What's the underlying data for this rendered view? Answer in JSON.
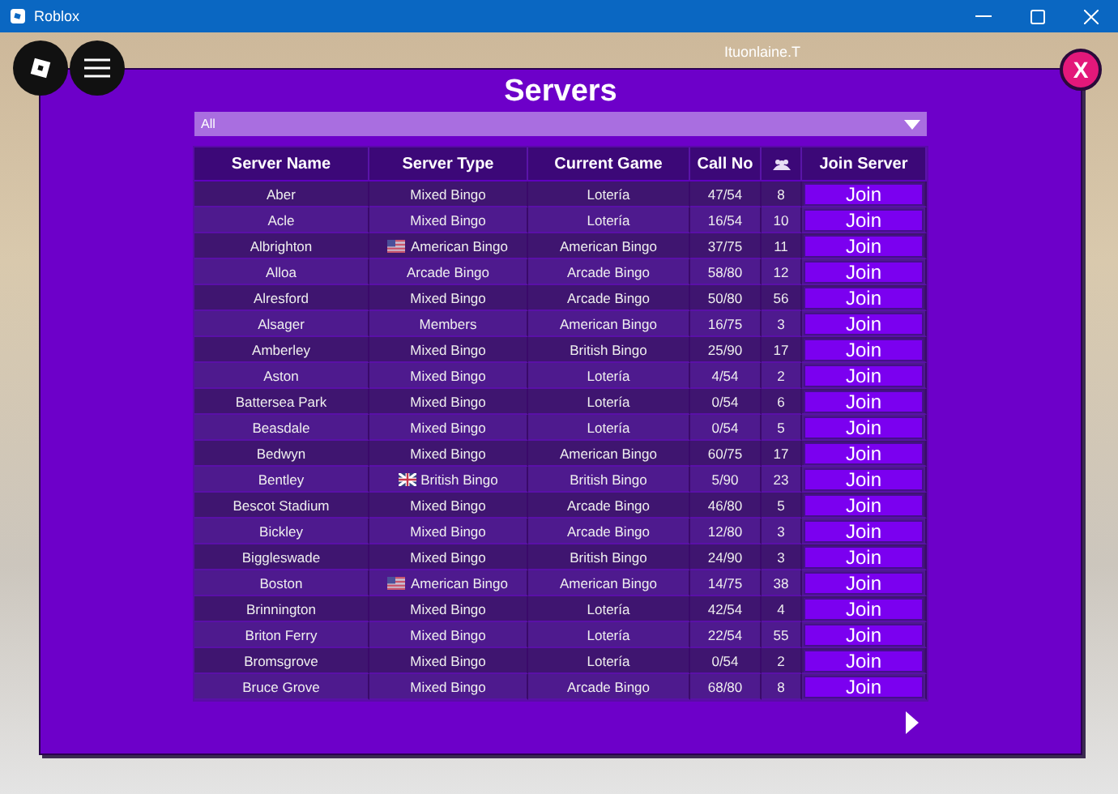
{
  "window": {
    "title": "Roblox"
  },
  "game": {
    "player_name": "Ituonlaine.T"
  },
  "panel": {
    "title": "Servers",
    "filter": {
      "value": "All"
    },
    "columns": [
      {
        "kind": "text",
        "label": "Server Name"
      },
      {
        "kind": "text",
        "label": "Server Type"
      },
      {
        "kind": "text",
        "label": "Current Game"
      },
      {
        "kind": "text",
        "label": "Call No"
      },
      {
        "kind": "icon"
      },
      {
        "kind": "text",
        "label": "Join Server"
      }
    ],
    "rows": [
      {
        "kind": "plain",
        "name": "Aber",
        "type": "Mixed Bingo",
        "game": "Lotería",
        "call": "47/54",
        "players": "8",
        "action": "Join"
      },
      {
        "kind": "plain",
        "name": "Acle",
        "type": "Mixed Bingo",
        "game": "Lotería",
        "call": "16/54",
        "players": "10",
        "action": "Join"
      },
      {
        "kind": "american",
        "name": "Albrighton",
        "type": "American Bingo",
        "game": "American Bingo",
        "call": "37/75",
        "players": "11",
        "action": "Join"
      },
      {
        "kind": "plain",
        "name": "Alloa",
        "type": "Arcade Bingo",
        "game": "Arcade Bingo",
        "call": "58/80",
        "players": "12",
        "action": "Join"
      },
      {
        "kind": "plain",
        "name": "Alresford",
        "type": "Mixed Bingo",
        "game": "Arcade Bingo",
        "call": "50/80",
        "players": "56",
        "action": "Join"
      },
      {
        "kind": "plain",
        "name": "Alsager",
        "type": "Members",
        "game": "American Bingo",
        "call": "16/75",
        "players": "3",
        "action": "Join"
      },
      {
        "kind": "plain",
        "name": "Amberley",
        "type": "Mixed Bingo",
        "game": "British Bingo",
        "call": "25/90",
        "players": "17",
        "action": "Join"
      },
      {
        "kind": "plain",
        "name": "Aston",
        "type": "Mixed Bingo",
        "game": "Lotería",
        "call": "4/54",
        "players": "2",
        "action": "Join"
      },
      {
        "kind": "plain",
        "name": "Battersea Park",
        "type": "Mixed Bingo",
        "game": "Lotería",
        "call": "0/54",
        "players": "6",
        "action": "Join"
      },
      {
        "kind": "plain",
        "name": "Beasdale",
        "type": "Mixed Bingo",
        "game": "Lotería",
        "call": "0/54",
        "players": "5",
        "action": "Join"
      },
      {
        "kind": "plain",
        "name": "Bedwyn",
        "type": "Mixed Bingo",
        "game": "American Bingo",
        "call": "60/75",
        "players": "17",
        "action": "Join"
      },
      {
        "kind": "british",
        "name": "Bentley",
        "type": "British Bingo",
        "game": "British Bingo",
        "call": "5/90",
        "players": "23",
        "action": "Join"
      },
      {
        "kind": "plain",
        "name": "Bescot Stadium",
        "type": "Mixed Bingo",
        "game": "Arcade Bingo",
        "call": "46/80",
        "players": "5",
        "action": "Join"
      },
      {
        "kind": "plain",
        "name": "Bickley",
        "type": "Mixed Bingo",
        "game": "Arcade Bingo",
        "call": "12/80",
        "players": "3",
        "action": "Join"
      },
      {
        "kind": "plain",
        "name": "Biggleswade",
        "type": "Mixed Bingo",
        "game": "British Bingo",
        "call": "24/90",
        "players": "3",
        "action": "Join"
      },
      {
        "kind": "american",
        "name": "Boston",
        "type": "American Bingo",
        "game": "American Bingo",
        "call": "14/75",
        "players": "38",
        "action": "Join"
      },
      {
        "kind": "plain",
        "name": "Brinnington",
        "type": "Mixed Bingo",
        "game": "Lotería",
        "call": "42/54",
        "players": "4",
        "action": "Join"
      },
      {
        "kind": "plain",
        "name": "Briton Ferry",
        "type": "Mixed Bingo",
        "game": "Lotería",
        "call": "22/54",
        "players": "55",
        "action": "Join"
      },
      {
        "kind": "plain",
        "name": "Bromsgrove",
        "type": "Mixed Bingo",
        "game": "Lotería",
        "call": "0/54",
        "players": "2",
        "action": "Join"
      },
      {
        "kind": "plain",
        "name": "Bruce Grove",
        "type": "Mixed Bingo",
        "game": "Arcade Bingo",
        "call": "68/80",
        "players": "8",
        "action": "Join"
      }
    ],
    "close_label": "X"
  }
}
